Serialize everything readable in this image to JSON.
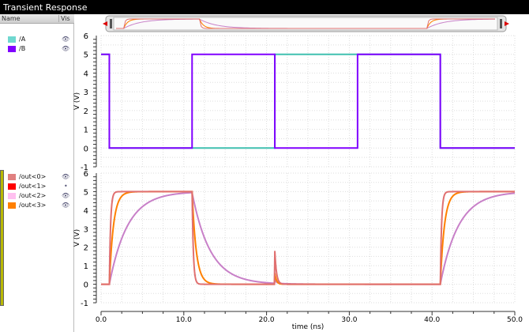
{
  "window": {
    "title": "Transient Response"
  },
  "legend_header": {
    "name": "Name",
    "vis": "Vis"
  },
  "panel1_signals": [
    {
      "name": "/A",
      "color": "#70d8d0",
      "visible": true
    },
    {
      "name": "/B",
      "color": "#8000ff",
      "visible": true
    }
  ],
  "panel2_signals": [
    {
      "name": "/out<0>",
      "color": "#e08080",
      "visible": true
    },
    {
      "name": "/out<1>",
      "color": "#ff0000",
      "visible": false
    },
    {
      "name": "/out<2>",
      "color": "#ffc0f0",
      "visible": true
    },
    {
      "name": "/out<3>",
      "color": "#ff8000",
      "visible": true
    }
  ],
  "chart_data": [
    {
      "type": "line",
      "ylabel": "V (V)",
      "ylim": [
        -1,
        6
      ],
      "yticks": [
        "-1",
        "0",
        "1",
        "2",
        "3",
        "4",
        "5",
        "6"
      ],
      "xlim": [
        0,
        50
      ],
      "grid": true,
      "series": [
        {
          "name": "/A",
          "color": "#40c0b0",
          "steps": [
            [
              0,
              5
            ],
            [
              1,
              0
            ],
            [
              21,
              5
            ],
            [
              41,
              0
            ]
          ]
        },
        {
          "name": "/B",
          "color": "#8000ff",
          "steps": [
            [
              0,
              5
            ],
            [
              1,
              0
            ],
            [
              11,
              5
            ],
            [
              21,
              0
            ],
            [
              31,
              5
            ],
            [
              41,
              0
            ]
          ]
        }
      ]
    },
    {
      "type": "line",
      "ylabel": "V (V)",
      "ylim": [
        -1,
        6
      ],
      "yticks": [
        "-1",
        "0",
        "1",
        "2",
        "3",
        "4",
        "5",
        "6"
      ],
      "xlim": [
        0,
        50
      ],
      "grid": true,
      "xlabel": "time (ns)",
      "xticks": [
        "0.0",
        "10.0",
        "20.0",
        "30.0",
        "40.0",
        "50.0"
      ],
      "series": [
        {
          "name": "/out<2>",
          "color": "#c880c8",
          "tau_ns": 2.2,
          "edges": [
            [
              1,
              5
            ],
            [
              11,
              0
            ],
            [
              41,
              5
            ]
          ],
          "glitch_at": 21,
          "glitch_peak": 0.2
        },
        {
          "name": "/out<3>",
          "color": "#ff8000",
          "tau_ns": 0.5,
          "edges": [
            [
              1,
              5
            ],
            [
              11,
              0
            ],
            [
              41,
              5
            ]
          ],
          "glitch_at": 21,
          "glitch_peak": 0.6
        },
        {
          "name": "/out<0>",
          "color": "#e07070",
          "tau_ns": 0.15,
          "edges": [
            [
              1,
              5
            ],
            [
              11,
              0
            ],
            [
              41,
              5
            ]
          ],
          "glitch_at": 21,
          "glitch_peak": 1.8
        }
      ]
    }
  ]
}
